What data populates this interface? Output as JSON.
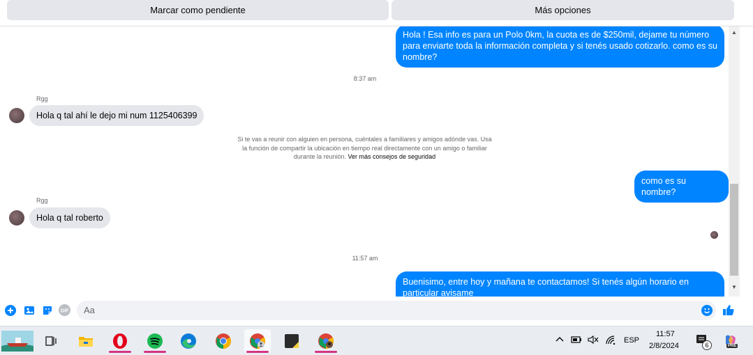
{
  "topbar": {
    "mark_pending": "Marcar como pendiente",
    "more_options": "Más opciones"
  },
  "messages": {
    "out1": "Hola ! Esa info es para un Polo 0km, la cuota es de $250mil, dejame tu número para enviarte toda la información completa y si tenés usado cotizarlo. como es su nombre?",
    "time1": "8:37 am",
    "sender1": "Rgg",
    "in1": "Hola q tal ahí le dejo mi num 1125406399",
    "notice": "Si te vas a reunir con alguien en persona, cuéntales a familiares y amigos adónde vas. Usa la función de compartir la ubicación en tiempo real directamente con un amigo o familiar durante la reunión.",
    "notice_link": "Ver más consejos de seguridad",
    "out2": "como es su nombre?",
    "sender2": "Rgg",
    "in2": "Hola q tal roberto",
    "time2": "11:57 am",
    "out3": "Buenisimo, entre hoy y mañana te contactamos! Si tenés algún horario en particular avisame"
  },
  "composer": {
    "placeholder": "Aa",
    "icons": [
      "plus-circle-icon",
      "photo-icon",
      "sticker-icon",
      "gif-icon",
      "emoji-icon",
      "like-icon"
    ]
  },
  "taskbar": {
    "apps": [
      "boat-wallpaper-icon",
      "task-view-icon",
      "file-explorer-icon",
      "opera-icon",
      "spotify-icon",
      "edge-icon",
      "chrome-icon",
      "chrome-profile-icon",
      "sticky-notes-icon",
      "chrome-profile2-icon"
    ],
    "language": "ESP",
    "time": "11:57",
    "date": "2/8/2024",
    "notification_count": "6",
    "copilot_badge": "PRE"
  },
  "colors": {
    "accent": "#0084ff",
    "incoming_bubble": "#e4e6eb",
    "taskbar": "#e9edf2"
  }
}
